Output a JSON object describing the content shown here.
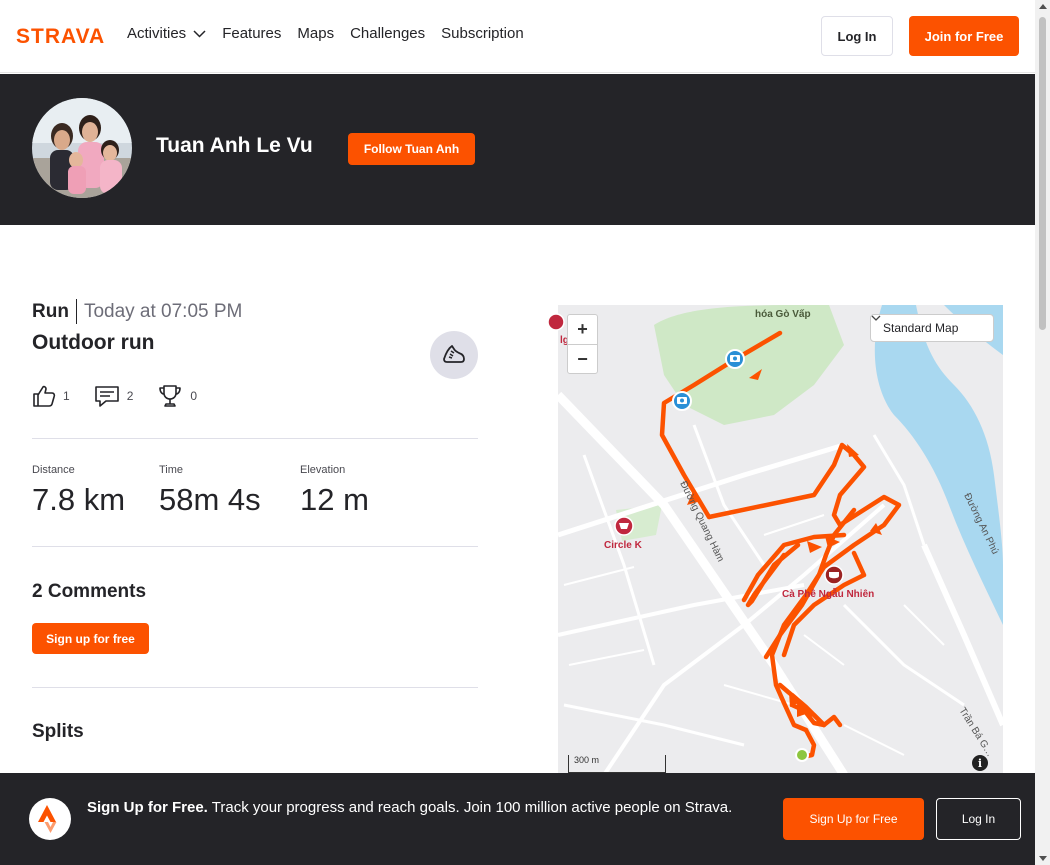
{
  "nav": {
    "brand": "STRAVA",
    "items": [
      {
        "label": "Activities",
        "has_dropdown": true
      },
      {
        "label": "Features"
      },
      {
        "label": "Maps"
      },
      {
        "label": "Challenges"
      },
      {
        "label": "Subscription"
      }
    ],
    "login_label": "Log In",
    "join_label": "Join for Free"
  },
  "athlete": {
    "name": "Tuan Anh Le Vu",
    "follow_label": "Follow Tuan Anh"
  },
  "activity": {
    "type": "Run",
    "date": "Today at 07:05 PM",
    "title": "Outdoor run",
    "kudos": "1",
    "comments": "2",
    "achievements": "0",
    "stats": [
      {
        "label": "Distance",
        "value": "7.8 km"
      },
      {
        "label": "Time",
        "value": "58m 4s"
      },
      {
        "label": "Elevation",
        "value": "12 m"
      }
    ]
  },
  "comments": {
    "title": "2 Comments",
    "signup_label": "Sign up for free"
  },
  "splits": {
    "title": "Splits"
  },
  "map": {
    "style_label": "Standard Map",
    "zoom_in": "+",
    "zoom_out": "−",
    "scale_label": "300 m",
    "labels": {
      "poi_gv": "hóa Gò Vấp",
      "poi_left": "lgo…ic",
      "street1": "Đường Quang Hàm",
      "store": "Circle K",
      "cafe": "Cà Phê Ngẫu Nhiên",
      "street2": "Đường An Phú",
      "street3": "Trần Bá G…"
    },
    "colors": {
      "route": "#fc5200",
      "river": "#a9d8f0",
      "park": "#cfe8c6",
      "poi": "#c0283e",
      "photo_pin": "#2a8fd6"
    }
  },
  "banner": {
    "bold": "Sign Up for Free.",
    "text": "Track your progress and reach goals. Join 100 million active people on Strava.",
    "signup_label": "Sign Up for Free",
    "login_label": "Log In"
  },
  "theme": {
    "accent": "#fc5200",
    "dark": "#242428"
  }
}
